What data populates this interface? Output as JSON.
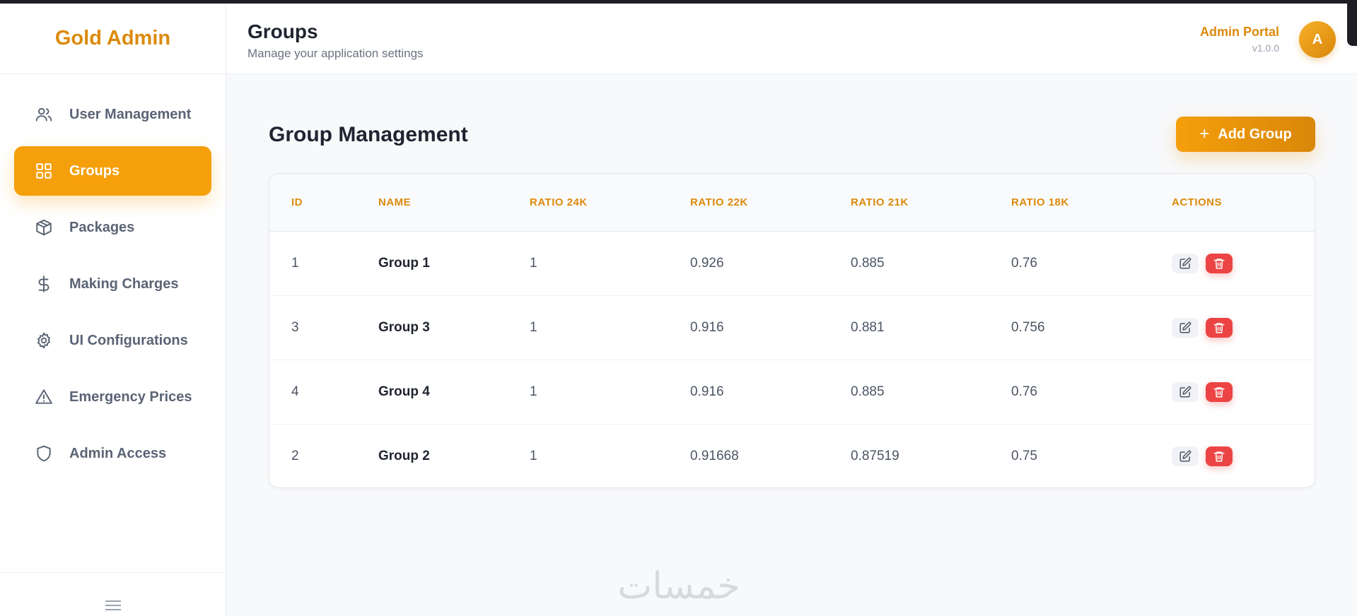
{
  "brand": {
    "name": "Gold Admin"
  },
  "sidebar": {
    "items": [
      {
        "label": "User Management",
        "icon": "users-icon",
        "active": false
      },
      {
        "label": "Groups",
        "icon": "grid-icon",
        "active": true
      },
      {
        "label": "Packages",
        "icon": "package-icon",
        "active": false
      },
      {
        "label": "Making Charges",
        "icon": "dollar-icon",
        "active": false
      },
      {
        "label": "UI Configurations",
        "icon": "gear-icon",
        "active": false
      },
      {
        "label": "Emergency Prices",
        "icon": "warning-icon",
        "active": false
      },
      {
        "label": "Admin Access",
        "icon": "shield-icon",
        "active": false
      }
    ]
  },
  "header": {
    "title": "Groups",
    "subtitle": "Manage your application settings",
    "portal_title": "Admin Portal",
    "portal_version": "v1.0.0",
    "avatar_initial": "A"
  },
  "main": {
    "section_title": "Group Management",
    "add_button_label": "Add Group",
    "table": {
      "columns": [
        "ID",
        "NAME",
        "RATIO 24K",
        "RATIO 22K",
        "RATIO 21K",
        "RATIO 18K",
        "ACTIONS"
      ],
      "rows": [
        {
          "id": "1",
          "name": "Group 1",
          "r24": "1",
          "r22": "0.926",
          "r21": "0.885",
          "r18": "0.76"
        },
        {
          "id": "3",
          "name": "Group 3",
          "r24": "1",
          "r22": "0.916",
          "r21": "0.881",
          "r18": "0.756"
        },
        {
          "id": "4",
          "name": "Group 4",
          "r24": "1",
          "r22": "0.916",
          "r21": "0.885",
          "r18": "0.76"
        },
        {
          "id": "2",
          "name": "Group 2",
          "r24": "1",
          "r22": "0.91668",
          "r21": "0.87519",
          "r18": "0.75"
        }
      ]
    }
  },
  "watermark": {
    "text": "خمسات"
  },
  "colors": {
    "accent": "#f59f0b",
    "accent_text": "#dc8a0c",
    "danger": "#ec4444",
    "background": "#f8f9fb"
  }
}
